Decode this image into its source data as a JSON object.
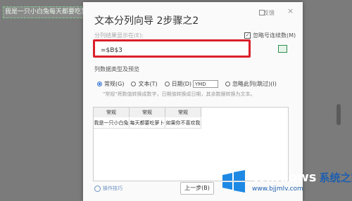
{
  "sheet": {
    "cell_text": "我是一只小白兔每天都要吃萝卜 如"
  },
  "dialog": {
    "title": "文本分列向导 2步骤之2",
    "feedback": "反馈",
    "close": "×",
    "destination_label": "分列结果显示在(E):",
    "destination_value": "=$B$3",
    "skip_checkbox_label": "忽略号连续数(M)",
    "column_format_label": "列数据类型及预览",
    "radio": {
      "general": "常规(G)",
      "text": "文本(T)",
      "date": "日期(D)",
      "date_format": "YMD",
      "skip": "忽略此列(跳过)(I)"
    },
    "hint": "\"常规\"将数值转换成数字，日期值转换成日期，其余数据转换为文本。",
    "preview": {
      "headers": [
        "常规",
        "常规",
        "常规"
      ],
      "row": [
        "我是一只小白兔",
        "每天都要吃萝卜",
        "如果你不喜欢我"
      ]
    },
    "tips": "操作技巧",
    "prev_button": "上一步(B)"
  },
  "watermark": {
    "brand": "Windows",
    "brand_cn": "系统之家",
    "url": "www.bjjmlv.com"
  },
  "colors": {
    "highlight_border": "#d9202b",
    "accent": "#2f6fd1"
  }
}
